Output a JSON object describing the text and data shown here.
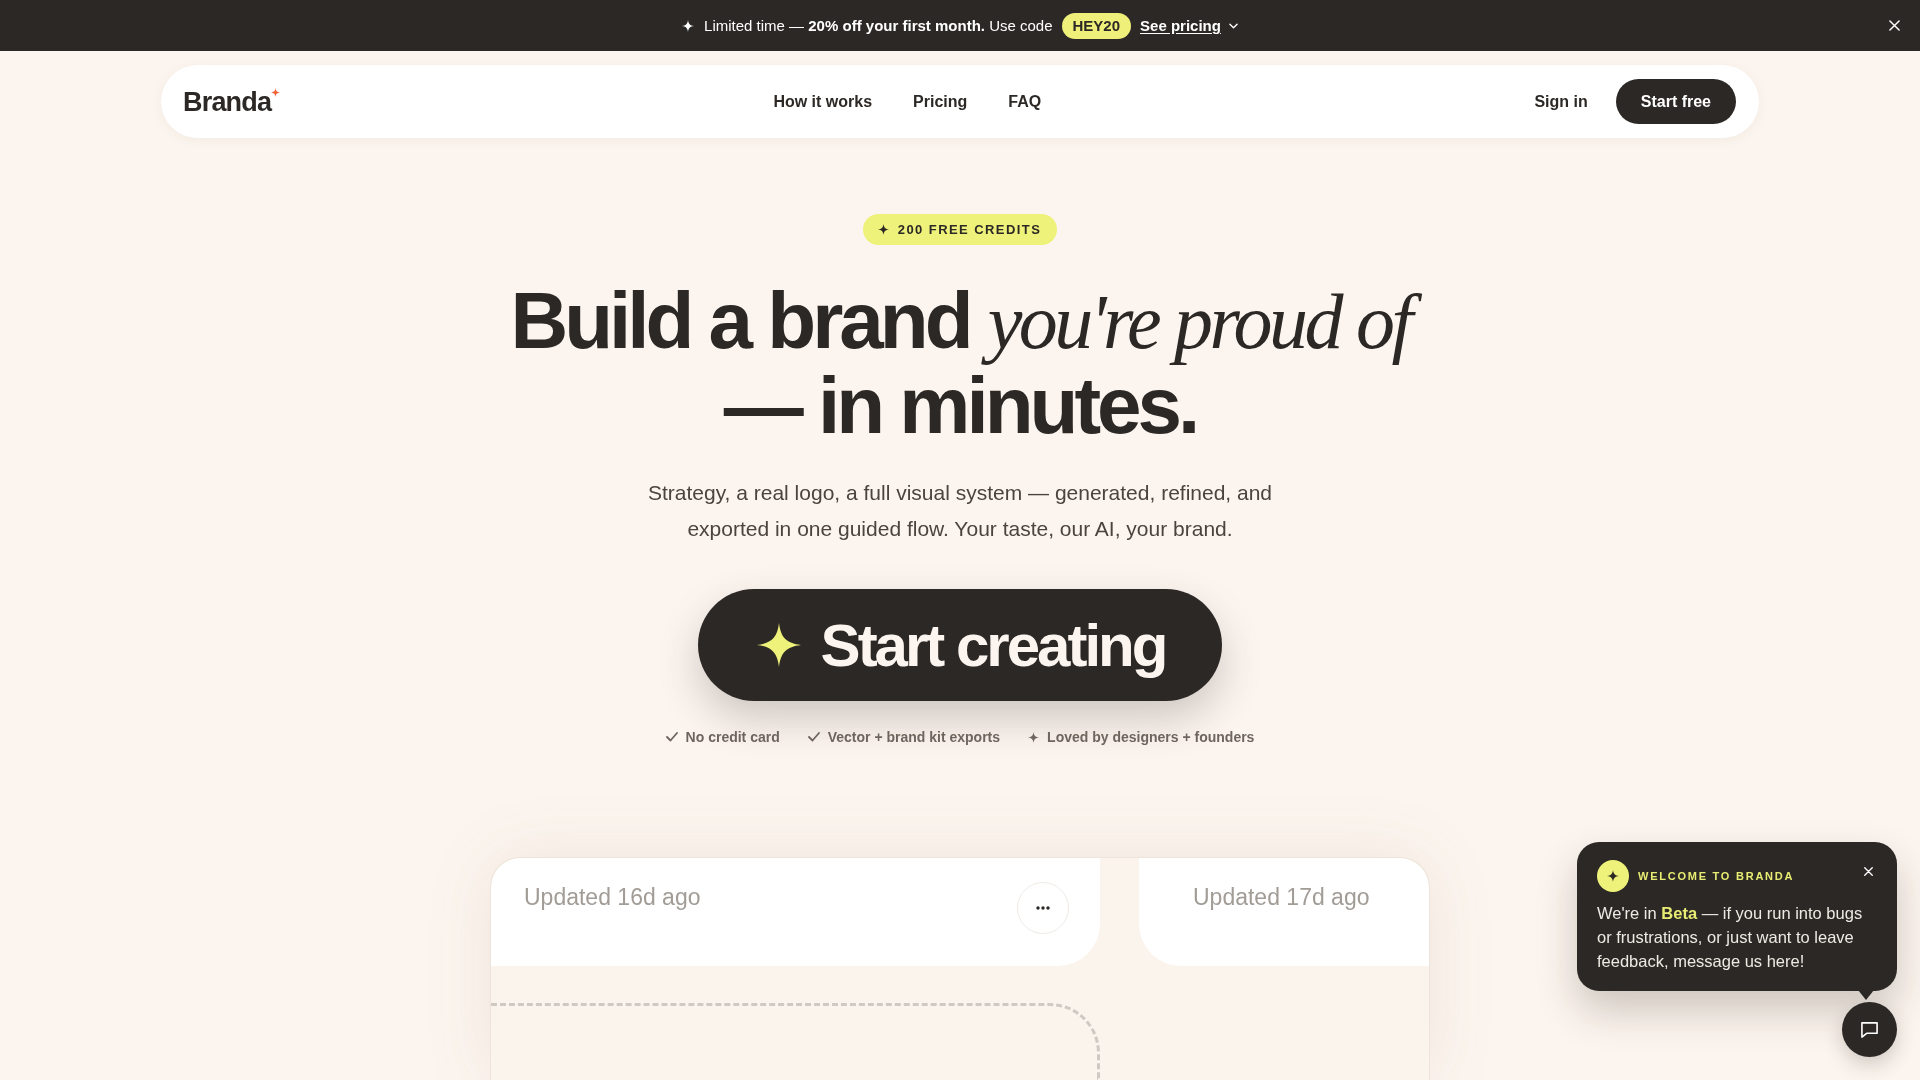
{
  "promo_banner": {
    "text": "Limited time — **20% off your first month.** Use code",
    "code": "HEY20",
    "link": "See pricing"
  },
  "nav": {
    "logo": "Branda",
    "links": [
      "How it works",
      "Pricing",
      "FAQ"
    ],
    "sign_in": "Sign in",
    "cta": "Start free"
  },
  "hero": {
    "badge": "200 FREE CREDITS",
    "heading": "Build a brand *you're proud of* — in minutes.",
    "subtitle": "Strategy, a real logo, a full visual system — generated, refined, and exported in one guided flow. Your taste, our AI, your brand.",
    "cta": "Start creating",
    "perks": [
      {
        "kind": "check",
        "label": "No credit card"
      },
      {
        "kind": "check",
        "label": "Vector + brand kit exports"
      },
      {
        "kind": "sparkle",
        "label": "Loved by designers + founders"
      }
    ]
  },
  "preview": {
    "cards": [
      {
        "updated": "Updated 16d ago",
        "menu": true
      },
      {
        "updated": "Updated 17d ago",
        "menu": false
      }
    ]
  },
  "chat_popup": {
    "title": "WELCOME TO BRANDA",
    "message": "We're in **Beta** — if you run into bugs or frustrations, or just want to leave feedback, message us here!"
  }
}
